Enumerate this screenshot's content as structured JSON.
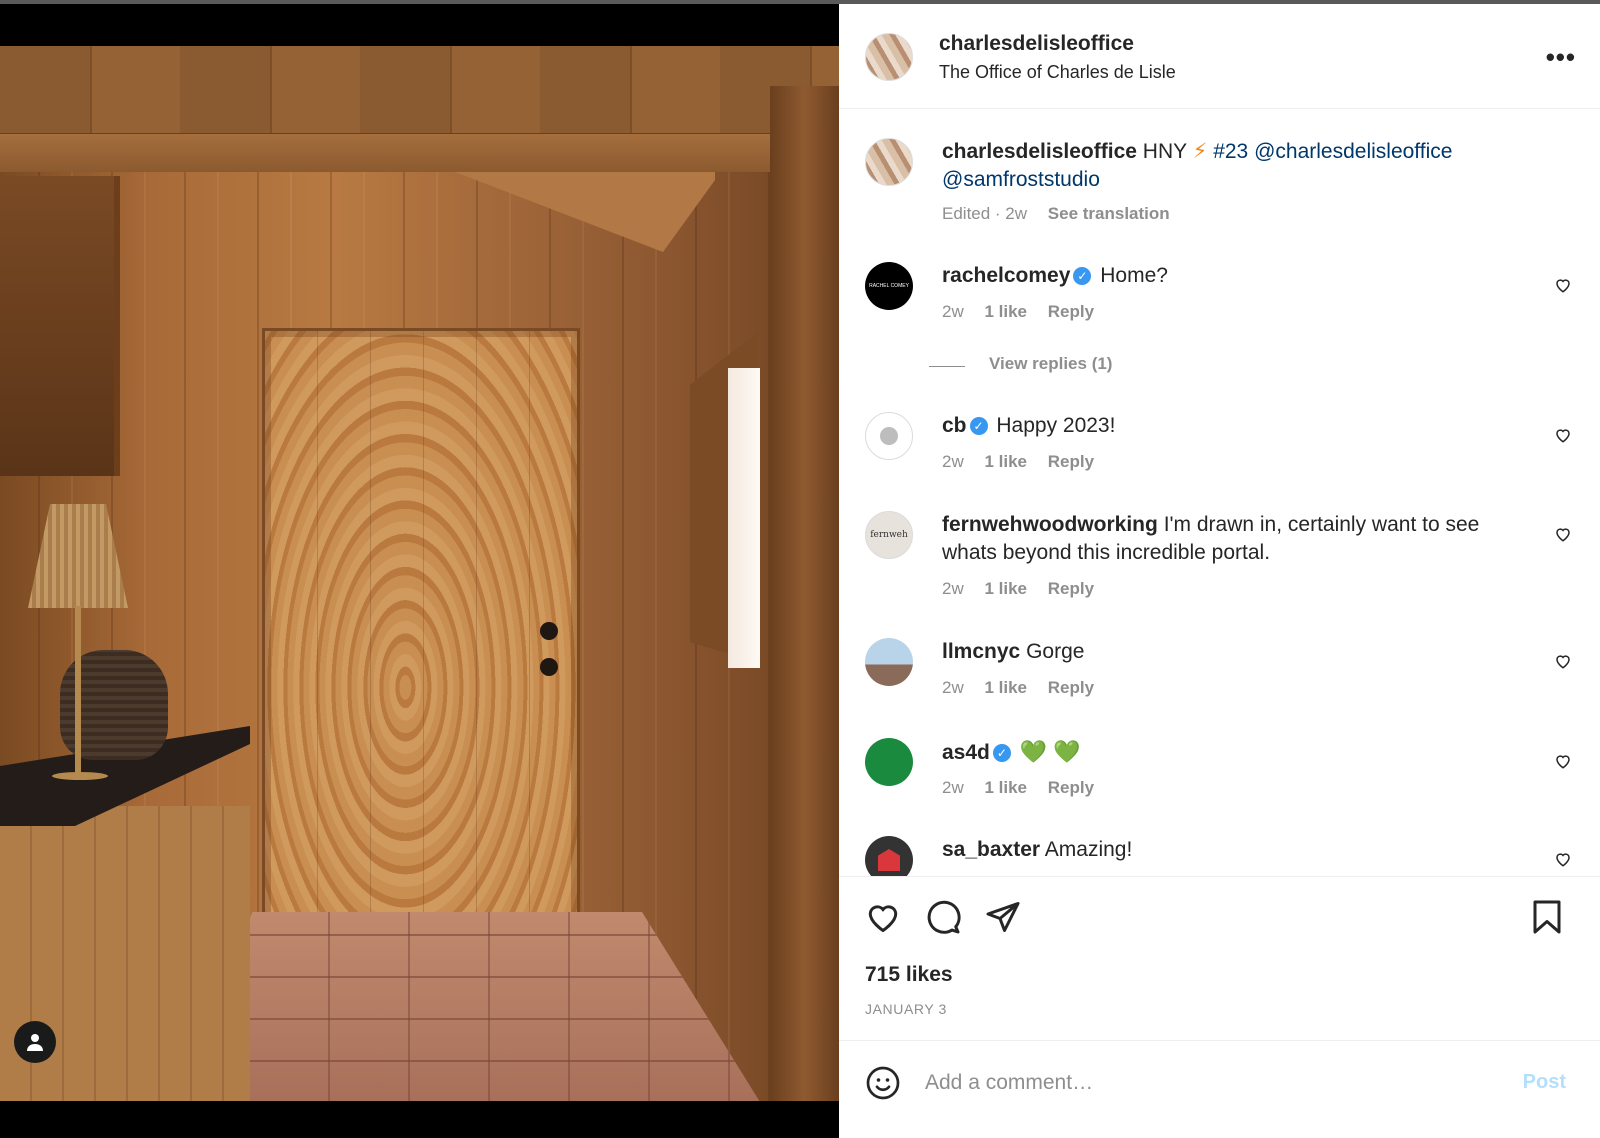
{
  "post": {
    "author": "charlesdelisleoffice",
    "author_subtitle": "The Office of Charles de Lisle",
    "more_label": "•••",
    "caption": {
      "username": "charlesdelisleoffice",
      "text_lead": "HNY",
      "bolt_emoji": "⚡",
      "tag": "#23",
      "mention1": "@charlesdelisleoffice",
      "mention2": "@samfroststudio",
      "edited": "Edited · 2w",
      "see_translation": "See translation"
    },
    "likes": "715 likes",
    "date": "JANUARY 3"
  },
  "comments": [
    {
      "username": "rachelcomey",
      "verified": true,
      "text": "Home?",
      "time": "2w",
      "likes": "1 like",
      "reply": "Reply",
      "view_replies": "View replies (1)"
    },
    {
      "username": "cb",
      "verified": true,
      "text": "Happy 2023!",
      "time": "2w",
      "likes": "1 like",
      "reply": "Reply"
    },
    {
      "username": "fernwehwoodworking",
      "verified": false,
      "text": "I'm drawn in, certainly want to see whats beyond this incredible portal.",
      "time": "2w",
      "likes": "1 like",
      "reply": "Reply"
    },
    {
      "username": "llmcnyc",
      "verified": false,
      "text": "Gorge",
      "time": "2w",
      "likes": "1 like",
      "reply": "Reply"
    },
    {
      "username": "as4d",
      "verified": true,
      "text": "💚 💚",
      "time": "2w",
      "likes": "1 like",
      "reply": "Reply"
    },
    {
      "username": "sa_baxter",
      "verified": false,
      "text": "Amazing!",
      "time": "",
      "likes": "",
      "reply": ""
    }
  ],
  "avatar_labels": {
    "rachelcomey": "RACHEL COMEY",
    "fernweh": "fernweh"
  },
  "composer": {
    "placeholder": "Add a comment…",
    "post_label": "Post"
  },
  "icons": [
    "more-icon",
    "heart-icon",
    "comment-icon",
    "share-icon",
    "bookmark-icon",
    "emoji-icon",
    "verified-badge",
    "user-tag-icon"
  ],
  "colors": {
    "link": "#00376b",
    "verified": "#3897f0",
    "post_button": "#b2dffc",
    "meta": "#8e8e8e"
  }
}
